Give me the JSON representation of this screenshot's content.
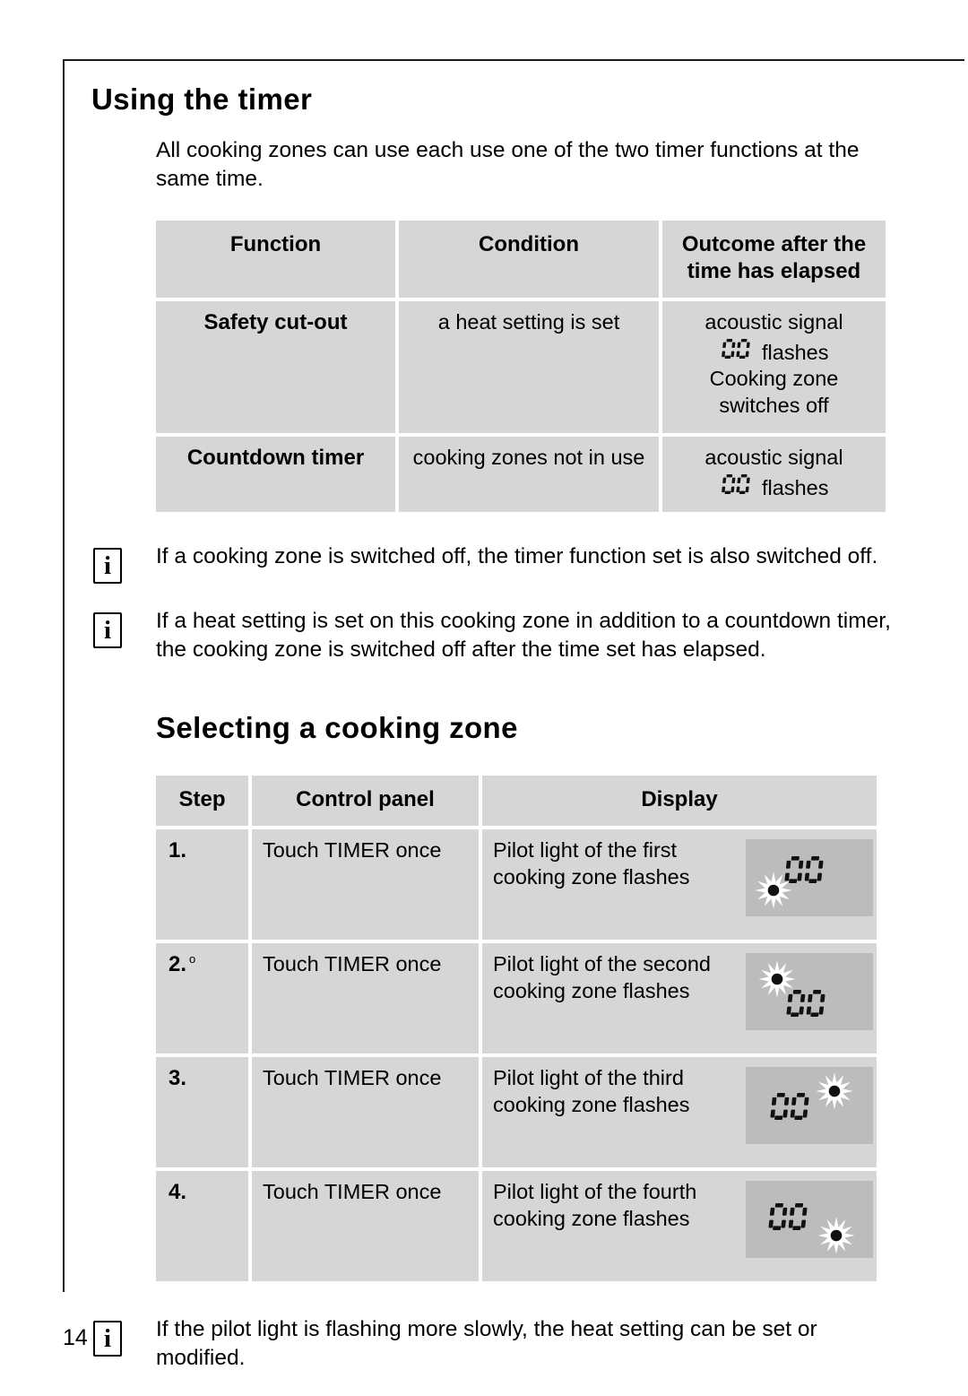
{
  "page": {
    "number": "14"
  },
  "sections": [
    {
      "id": "using-the-timer",
      "title": "Using the timer",
      "intro": "All cooking zones can use each use one of the two timer functions at the same time."
    },
    {
      "id": "selecting-a-cooking-zone",
      "title": "Selecting a cooking zone"
    }
  ],
  "timer_table": {
    "headers": [
      "Function",
      "Condition",
      "Outcome after the time has elapsed"
    ],
    "rows": [
      {
        "function": "Safety cut-out",
        "condition": "a heat setting is set",
        "outcome_lines": [
          "acoustic signal",
          "SEG00 flashes",
          "Cooking zone",
          "switches off"
        ],
        "outcome_line1": "acoustic signal",
        "outcome_line2_suffix": " flashes",
        "outcome_line3": "Cooking zone",
        "outcome_line4": "switches off"
      },
      {
        "function": "Countdown timer",
        "condition": "cooking zones not in use",
        "outcome_line1": "acoustic signal",
        "outcome_line2_suffix": " flashes"
      }
    ],
    "segment_value": "00"
  },
  "notes_top": [
    {
      "icon": "info-icon",
      "icon_glyph": "i",
      "text": "If a cooking zone is switched off, the timer function set is also switched off."
    },
    {
      "icon": "info-icon",
      "icon_glyph": "i",
      "text": "If a heat setting is set on this cooking zone in addition to a countdown timer, the cooking zone is switched off after the time set has elapsed."
    }
  ],
  "zone_table": {
    "headers": [
      "Step",
      "Control panel",
      "Display"
    ],
    "rows": [
      {
        "step": "1.",
        "control_panel": "Touch TIMER once",
        "display_text": "Pilot light of the first cooking zone flashes",
        "lcd": {
          "digits": "00",
          "pilot_position": "bottom-left"
        }
      },
      {
        "step": "2.",
        "step_superscript": "o",
        "control_panel": "Touch TIMER once",
        "display_text": "Pilot light of the second cooking zone flashes",
        "lcd": {
          "digits": "00",
          "pilot_position": "top-left"
        }
      },
      {
        "step": "3.",
        "control_panel": "Touch TIMER once",
        "display_text": "Pilot light of the third cooking zone flashes",
        "lcd": {
          "digits": "00",
          "pilot_position": "top-right"
        }
      },
      {
        "step": "4.",
        "control_panel": "Touch TIMER once",
        "display_text": "Pilot light of the fourth cooking zone flashes",
        "lcd": {
          "digits": "00",
          "pilot_position": "bottom-right"
        }
      }
    ]
  },
  "notes_bottom": [
    {
      "icon": "info-icon",
      "icon_glyph": "i",
      "text": "If the pilot light is flashing more slowly, the heat setting can be set or modified."
    }
  ],
  "colors": {
    "cell_bg": "#d6d6d6",
    "lcd_bg": "#bcbcbc",
    "rule": "#1a1a1a",
    "text": "#000000"
  }
}
